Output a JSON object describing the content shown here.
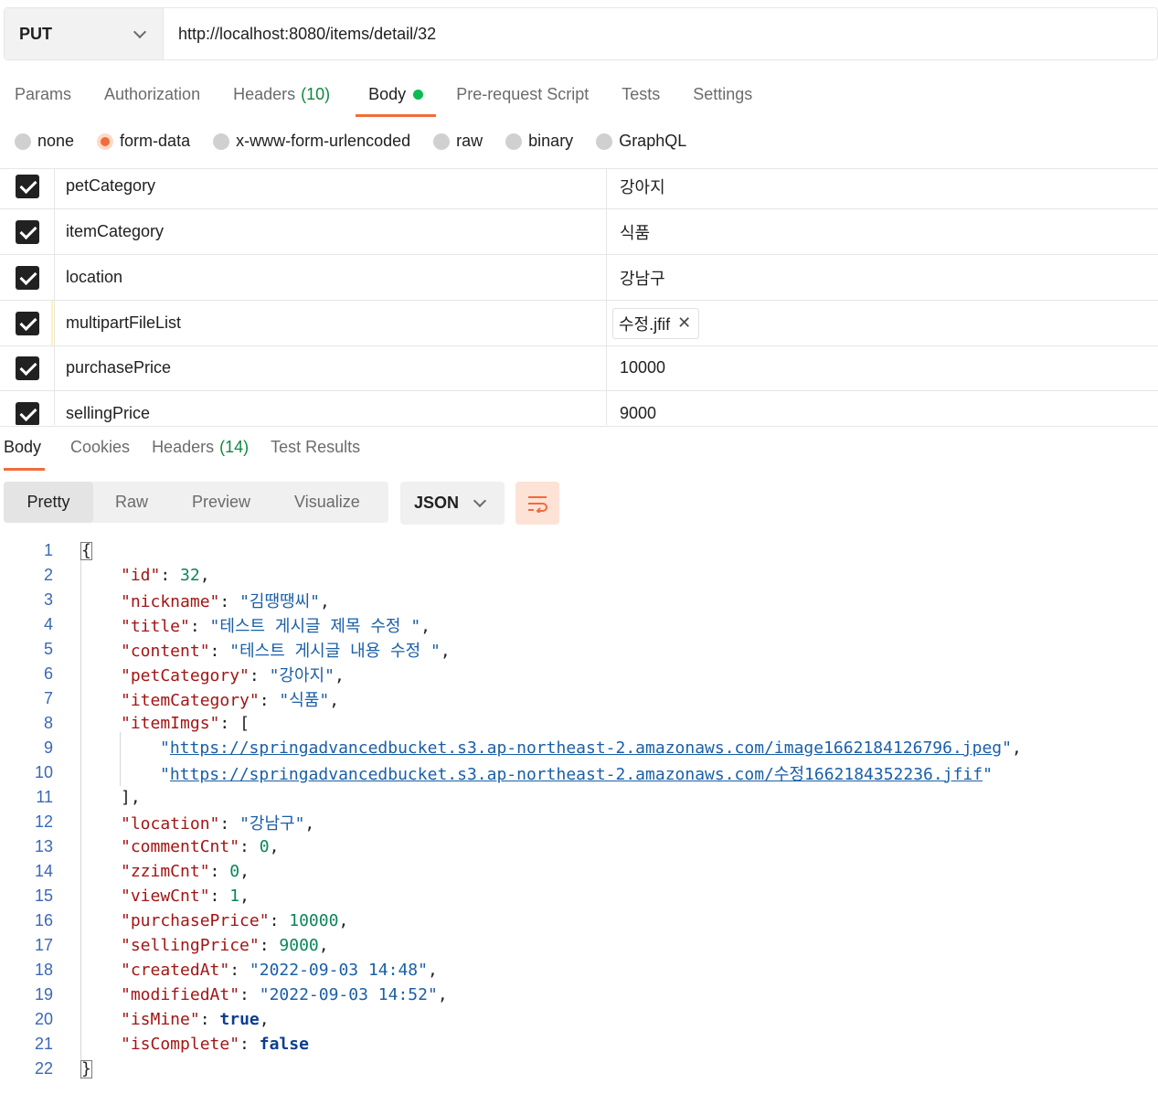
{
  "request": {
    "method": "PUT",
    "url": "http://localhost:8080/items/detail/32"
  },
  "request_tabs": [
    {
      "label": "Params"
    },
    {
      "label": "Authorization"
    },
    {
      "label": "Headers",
      "count": "(10)"
    },
    {
      "label": "Body"
    },
    {
      "label": "Pre-request Script"
    },
    {
      "label": "Tests"
    },
    {
      "label": "Settings"
    }
  ],
  "body_types": [
    "none",
    "form-data",
    "x-www-form-urlencoded",
    "raw",
    "binary",
    "GraphQL"
  ],
  "selected_body_type": "form-data",
  "form_rows": [
    {
      "key": "petCategory",
      "value": "강아지"
    },
    {
      "key": "itemCategory",
      "value": "식품"
    },
    {
      "key": "location",
      "value": "강남구"
    },
    {
      "key": "multipartFileList",
      "value": "수정.jfif"
    },
    {
      "key": "purchasePrice",
      "value": "10000"
    },
    {
      "key": "sellingPrice",
      "value": "9000"
    }
  ],
  "response_tabs": [
    {
      "label": "Body"
    },
    {
      "label": "Cookies"
    },
    {
      "label": "Headers",
      "count": "(14)"
    },
    {
      "label": "Test Results"
    }
  ],
  "view_modes": [
    "Pretty",
    "Raw",
    "Preview",
    "Visualize"
  ],
  "language": "JSON",
  "line_numbers": [
    "1",
    "2",
    "3",
    "4",
    "5",
    "6",
    "7",
    "8",
    "9",
    "10",
    "11",
    "12",
    "13",
    "14",
    "15",
    "16",
    "17",
    "18",
    "19",
    "20",
    "21",
    "22"
  ],
  "json_body": {
    "open": "{",
    "close": "}",
    "id": {
      "key": "\"id\"",
      "value": "32"
    },
    "nickname": {
      "key": "\"nickname\"",
      "value": "\"김땡땡씨\""
    },
    "title": {
      "key": "\"title\"",
      "value": "\"테스트 게시글 제목 수정 \""
    },
    "content": {
      "key": "\"content\"",
      "value": "\"테스트 게시글 내용 수정 \""
    },
    "petCategory": {
      "key": "\"petCategory\"",
      "value": "\"강아지\""
    },
    "itemCategory": {
      "key": "\"itemCategory\"",
      "value": "\"식품\""
    },
    "itemImgs": {
      "key": "\"itemImgs\"",
      "open": "[",
      "close": "],"
    },
    "img1": "https://springadvancedbucket.s3.ap-northeast-2.amazonaws.com/image1662184126796.jpeg",
    "img2": "https://springadvancedbucket.s3.ap-northeast-2.amazonaws.com/수정1662184352236.jfif",
    "location": {
      "key": "\"location\"",
      "value": "\"강남구\""
    },
    "commentCnt": {
      "key": "\"commentCnt\"",
      "value": "0"
    },
    "zzimCnt": {
      "key": "\"zzimCnt\"",
      "value": "0"
    },
    "viewCnt": {
      "key": "\"viewCnt\"",
      "value": "1"
    },
    "purchasePrice": {
      "key": "\"purchasePrice\"",
      "value": "10000"
    },
    "sellingPrice": {
      "key": "\"sellingPrice\"",
      "value": "9000"
    },
    "createdAt": {
      "key": "\"createdAt\"",
      "value": "\"2022-09-03 14:48\""
    },
    "modifiedAt": {
      "key": "\"modifiedAt\"",
      "value": "\"2022-09-03 14:52\""
    },
    "isMine": {
      "key": "\"isMine\"",
      "value": "true"
    },
    "isComplete": {
      "key": "\"isComplete\"",
      "value": "false"
    }
  },
  "colors": {
    "accent": "#f26b3a",
    "success": "#0cbb52",
    "count_green": "#0c8a3e",
    "json_key": "#a31515",
    "json_string": "#1a5fa8",
    "json_number": "#098658",
    "json_boolean": "#0b3e8f",
    "line_number": "#3b67b8"
  }
}
